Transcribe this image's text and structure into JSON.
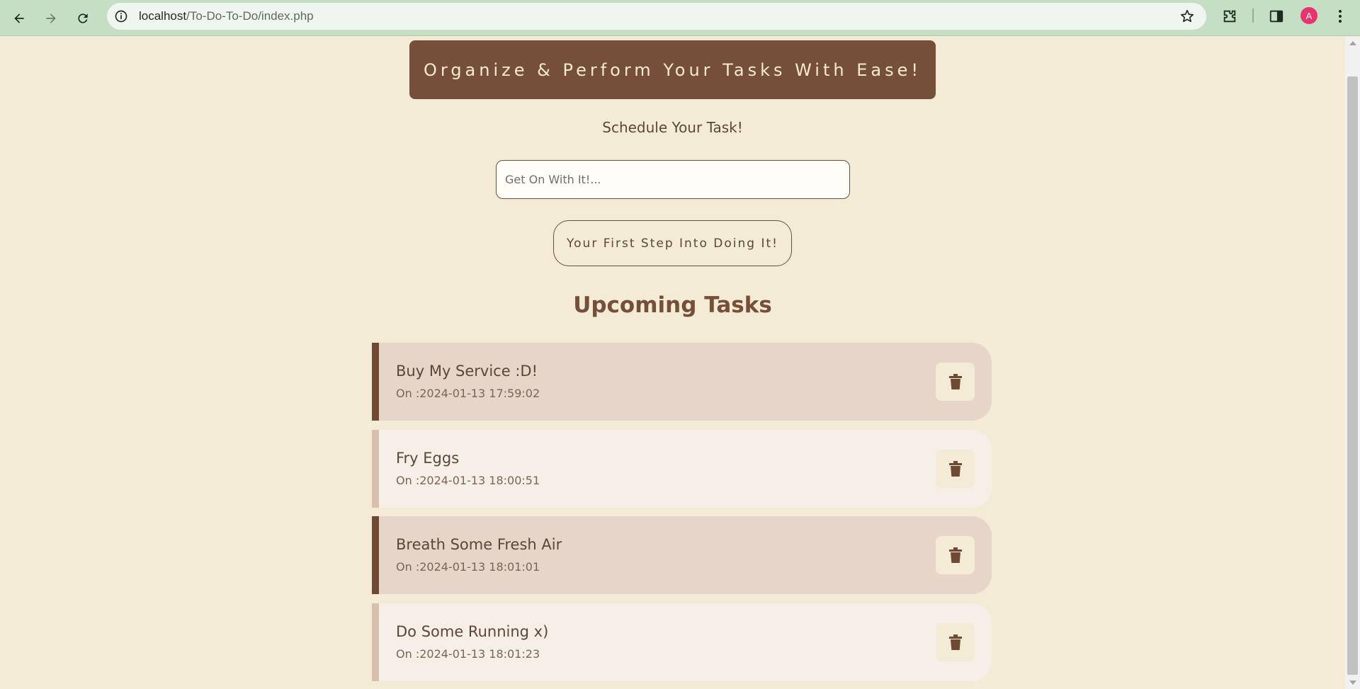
{
  "browser": {
    "url_host": "localhost",
    "url_path": "/To-Do-To-Do/index.php",
    "profile_initial": "A"
  },
  "page": {
    "banner_text": "Organize & Perform Your Tasks With Ease!",
    "subtitle": "Schedule Your Task!",
    "input_placeholder": "Get On With It!...",
    "input_value": "",
    "submit_label": "Your First Step Into Doing It!",
    "section_title": "Upcoming Tasks"
  },
  "tasks": [
    {
      "name": "Buy My Service :D!",
      "date": "On :2024-01-13 17:59:02"
    },
    {
      "name": "Fry Eggs",
      "date": "On :2024-01-13 18:00:51"
    },
    {
      "name": "Breath Some Fresh Air",
      "date": "On :2024-01-13 18:01:01"
    },
    {
      "name": "Do Some Running x)",
      "date": "On :2024-01-13 18:01:23"
    }
  ],
  "colors": {
    "page_bg": "#f3ebd6",
    "accent_brown": "#764f38",
    "task_dark_bg": "#e6d5c8",
    "task_light_bg": "#f5efe8"
  },
  "icons": [
    "back-icon",
    "forward-icon",
    "reload-icon",
    "info-icon",
    "star-icon",
    "extensions-icon",
    "side-panel-icon",
    "menu-icon",
    "trash-icon"
  ]
}
